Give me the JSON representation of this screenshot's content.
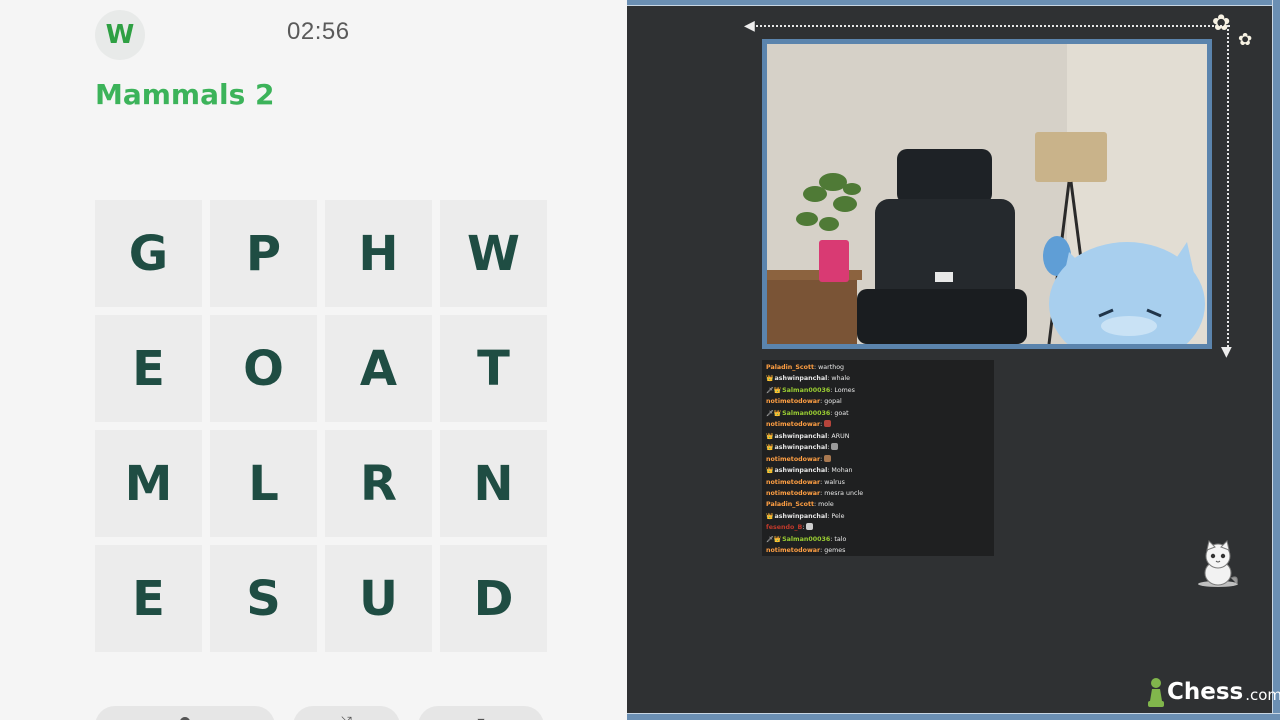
{
  "game": {
    "logo_letter": "W",
    "timer": "02:56",
    "title": "Mammals 2",
    "tiles": [
      "G",
      "P",
      "H",
      "W",
      "E",
      "O",
      "A",
      "T",
      "M",
      "L",
      "R",
      "N",
      "E",
      "S",
      "U",
      "D"
    ],
    "accent_color": "#3cb35a",
    "tile_text_color": "#1f4d43"
  },
  "stream": {
    "frame_color": "#6b8fb3",
    "chat": [
      {
        "badge": "",
        "user": "Paladin_Scott",
        "user_color": "#ff9f43",
        "text": "warthog"
      },
      {
        "badge": "👑",
        "user": "ashwinpanchal",
        "user_color": "#e6e6e6",
        "text": "whale"
      },
      {
        "badge": "🗡👑",
        "user": "Salman00036",
        "user_color": "#9acd32",
        "text": "Lomes"
      },
      {
        "badge": "",
        "user": "notimetodowar",
        "user_color": "#ff9f43",
        "text": "gopal"
      },
      {
        "badge": "🗡👑",
        "user": "Salman00036",
        "user_color": "#9acd32",
        "text": "goat"
      },
      {
        "badge": "",
        "user": "notimetodowar",
        "user_color": "#ff9f43",
        "text": "",
        "emote": "#b5443b"
      },
      {
        "badge": "👑",
        "user": "ashwinpanchal",
        "user_color": "#e6e6e6",
        "text": "ARUN"
      },
      {
        "badge": "👑",
        "user": "ashwinpanchal",
        "user_color": "#e6e6e6",
        "text": "",
        "emote": "#9a9a9a"
      },
      {
        "badge": "",
        "user": "notimetodowar",
        "user_color": "#ff9f43",
        "text": "",
        "emote": "#a87850"
      },
      {
        "badge": "👑",
        "user": "ashwinpanchal",
        "user_color": "#e6e6e6",
        "text": "Mohan"
      },
      {
        "badge": "",
        "user": "notimetodowar",
        "user_color": "#ff9f43",
        "text": "walrus"
      },
      {
        "badge": "",
        "user": "notimetodowar",
        "user_color": "#ff9f43",
        "text": "mesra uncle"
      },
      {
        "badge": "",
        "user": "Paladin_Scott",
        "user_color": "#ff9f43",
        "text": "mole"
      },
      {
        "badge": "👑",
        "user": "ashwinpanchal",
        "user_color": "#e6e6e6",
        "text": "Pele"
      },
      {
        "badge": "",
        "user": "fesendo_B",
        "user_color": "#c0392b",
        "text": "",
        "emote": "#cfcfcf"
      },
      {
        "badge": "🗡👑",
        "user": "Salman00036",
        "user_color": "#9acd32",
        "text": "talo"
      },
      {
        "badge": "",
        "user": "notimetodowar",
        "user_color": "#ff9f43",
        "text": "gemes"
      }
    ],
    "sponsor_main": "Chess",
    "sponsor_tld": ".com"
  }
}
